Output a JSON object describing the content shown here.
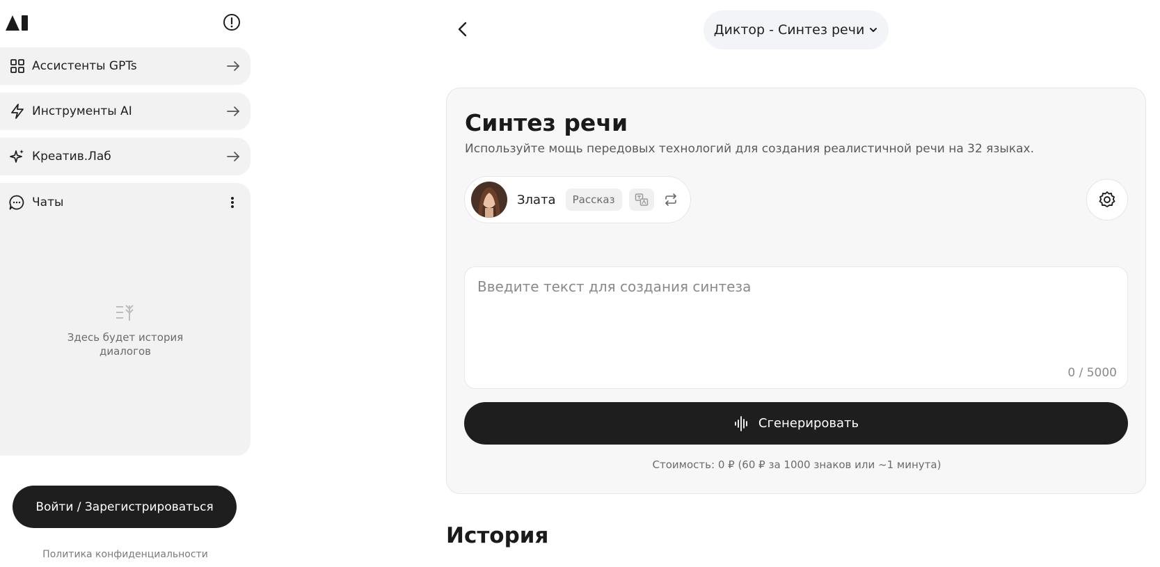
{
  "sidebar": {
    "nav": [
      {
        "label": "Ассистенты GPTs",
        "icon": "grid-icon"
      },
      {
        "label": "Инструменты AI",
        "icon": "lightning-icon"
      },
      {
        "label": "Креатив.Лаб",
        "icon": "sparkle-icon"
      }
    ],
    "chats": {
      "label": "Чаты",
      "empty_text": "Здесь будет история диалогов"
    },
    "login_label": "Войти / Зарегистрироваться",
    "privacy_label": "Политика конфиденциальности"
  },
  "header": {
    "mode_label": "Диктор - Синтез речи"
  },
  "card": {
    "title": "Синтез речи",
    "subtitle": "Используйте мощь передовых технологий для создания реалистичной речи на 32 языках.",
    "voice": {
      "name": "Злата",
      "tag": "Рассказ"
    },
    "input": {
      "placeholder": "Введите текст для создания синтеза",
      "counter": "0 / 5000"
    },
    "generate_label": "Сгенерировать",
    "cost_text": "Стоимость: 0 ₽ (60 ₽ за 1000 знаков или ~1 минута)"
  },
  "history_title": "История",
  "colors": {
    "dark": "#1e1e1e",
    "panel": "#f2f2f2",
    "card": "#f7f7f7"
  }
}
